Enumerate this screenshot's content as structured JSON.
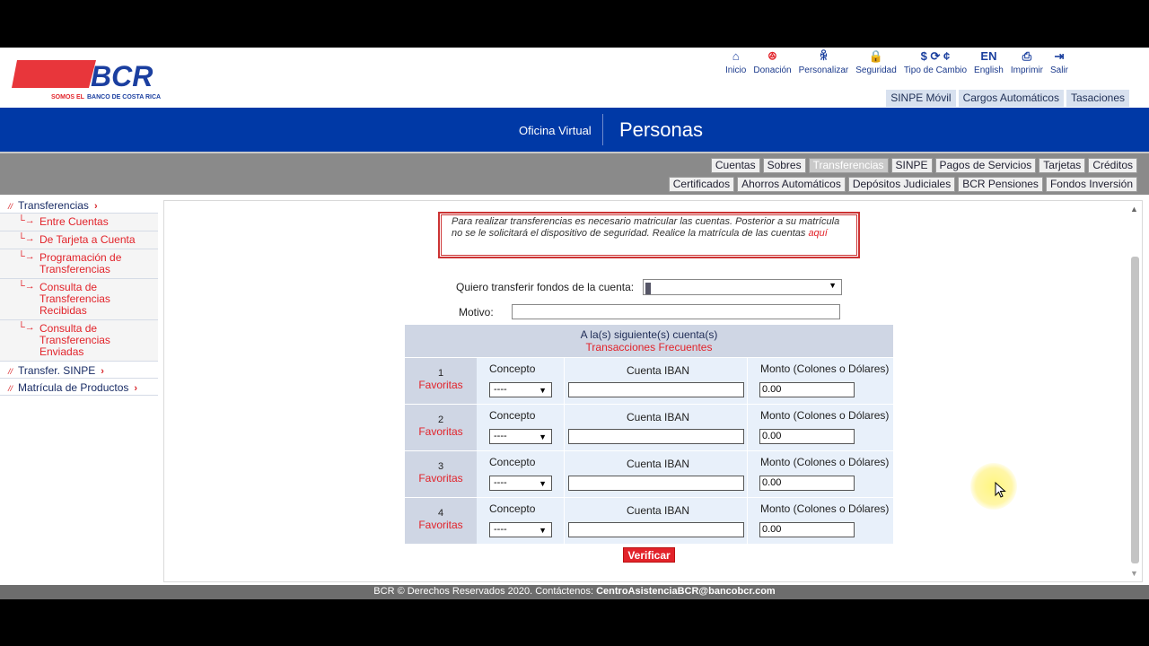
{
  "header": {
    "logo_text": "BCR",
    "logo_tagline_a": "SOMOS EL",
    "logo_tagline_b": "BANCO DE COSTA RICA",
    "topnav": [
      {
        "label": "Inicio",
        "icon": "home-icon",
        "glyph": "⌂"
      },
      {
        "label": "Donación",
        "icon": "people-icon",
        "glyph": "ꔮ"
      },
      {
        "label": "Personalizar",
        "icon": "person-pair-icon",
        "glyph": "ꆜ"
      },
      {
        "label": "Seguridad",
        "icon": "lock-icon",
        "glyph": "🔒"
      },
      {
        "label": "Tipo de Cambio",
        "icon": "exchange-icon",
        "glyph": "$ ⟳ ¢"
      },
      {
        "label": "English",
        "icon": "language-icon",
        "glyph": "EN"
      },
      {
        "label": "Imprimir",
        "icon": "printer-icon",
        "glyph": "⎙"
      },
      {
        "label": "Salir",
        "icon": "logout-icon",
        "glyph": "⇥"
      }
    ],
    "quicklinks": [
      "SINPE Móvil",
      "Cargos Automáticos",
      "Tasaciones"
    ]
  },
  "banner": {
    "subtitle": "Oficina Virtual",
    "title": "Personas"
  },
  "menu": {
    "row1": [
      "Cuentas",
      "Sobres",
      "Transferencias",
      "SINPE",
      "Pagos de Servicios",
      "Tarjetas",
      "Créditos"
    ],
    "row2": [
      "Certificados",
      "Ahorros Automáticos",
      "Depósitos Judiciales",
      "BCR Pensiones",
      "Fondos Inversión"
    ],
    "active": "Transferencias"
  },
  "sidebar": {
    "sections": [
      {
        "label": "Transferencias"
      },
      {
        "label": "Transfer. SINPE"
      },
      {
        "label": "Matrícula de Productos"
      }
    ],
    "subitems": [
      "Entre Cuentas",
      "De Tarjeta a Cuenta",
      "Programación de Transferencias",
      "Consulta de Transferencias Recibidas",
      "Consulta de Transferencias Enviadas"
    ]
  },
  "form": {
    "notice_text": "Para realizar transferencias es necesario matricular las cuentas. Posterior a su matrícula no se le solicitará el dispositivo de seguridad. Realice la matrícula de las cuentas ",
    "notice_link": "aquí",
    "from_label": "Quiero transferir fondos de la cuenta:",
    "motivo_label": "Motivo:",
    "table_header": "A la(s) siguiente(s) cuenta(s)",
    "table_subheader": "Transacciones Frecuentes",
    "rows": [
      {
        "num": "1",
        "fav": "Favoritas",
        "concepto_label": "Concepto",
        "concepto_value": "----",
        "iban_label": "Cuenta IBAN",
        "monto_label": "Monto (Colones o Dólares)",
        "monto_value": "0.00"
      },
      {
        "num": "2",
        "fav": "Favoritas",
        "concepto_label": "Concepto",
        "concepto_value": "----",
        "iban_label": "Cuenta IBAN",
        "monto_label": "Monto (Colones o Dólares)",
        "monto_value": "0.00"
      },
      {
        "num": "3",
        "fav": "Favoritas",
        "concepto_label": "Concepto",
        "concepto_value": "----",
        "iban_label": "Cuenta IBAN",
        "monto_label": "Monto (Colones o Dólares)",
        "monto_value": "0.00"
      },
      {
        "num": "4",
        "fav": "Favoritas",
        "concepto_label": "Concepto",
        "concepto_value": "----",
        "iban_label": "Cuenta IBAN",
        "monto_label": "Monto (Colones o Dólares)",
        "monto_value": "0.00"
      }
    ],
    "verify_label": "Verificar"
  },
  "footer": {
    "text": "BCR © Derechos Reservados 2020. Contáctenos: ",
    "email": "CentroAsistenciaBCR@bancobcr.com"
  },
  "colors": {
    "brand_blue": "#0039a6",
    "brand_red": "#e2232a"
  }
}
